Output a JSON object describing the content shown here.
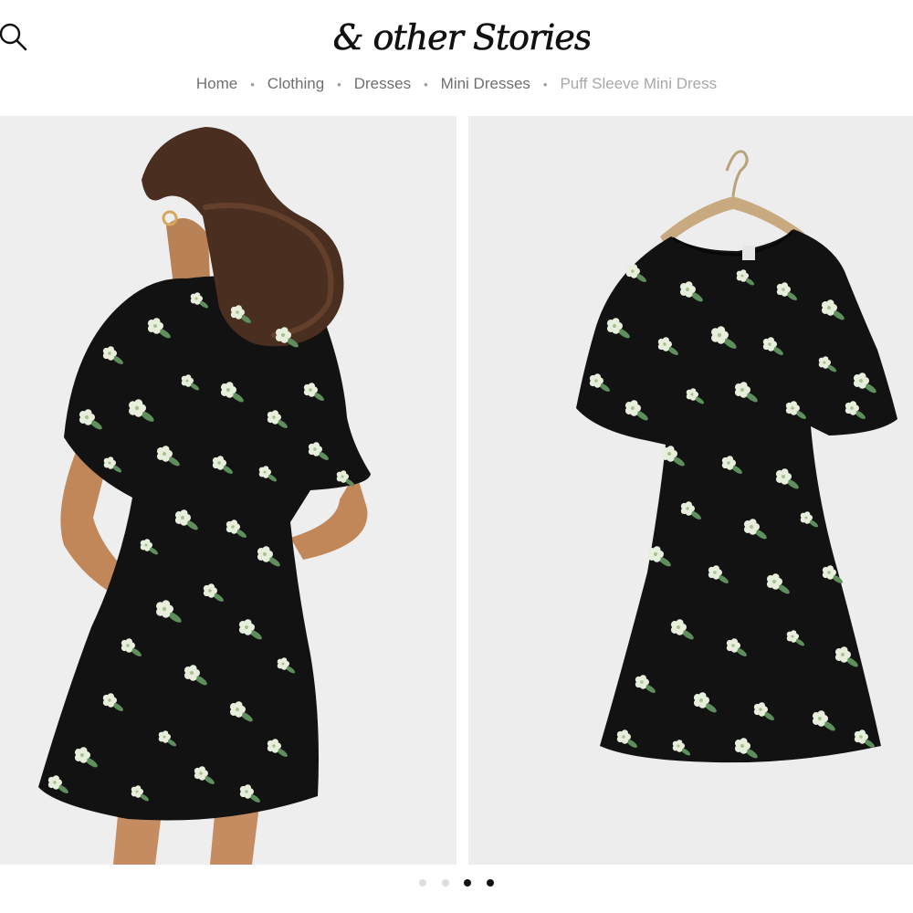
{
  "header": {
    "logo_text": "& other Stories",
    "search_icon": "search-icon"
  },
  "breadcrumb": [
    {
      "label": "Home"
    },
    {
      "label": "Clothing"
    },
    {
      "label": "Dresses"
    },
    {
      "label": "Mini Dresses"
    },
    {
      "label": "Puff Sleeve Mini Dress"
    }
  ],
  "breadcrumb_separator": "•",
  "gallery": {
    "images": [
      {
        "type": "model-back-view"
      },
      {
        "type": "dress-on-hanger"
      }
    ],
    "pagination": {
      "count": 4,
      "active": [
        2,
        3
      ]
    }
  },
  "colors": {
    "dress": "#121212",
    "flower": "#e8eedc",
    "leaf": "#5e8e5c",
    "skin": "#c58c61",
    "hair": "#5a3a25",
    "photo_bg": "#eeeeee"
  }
}
